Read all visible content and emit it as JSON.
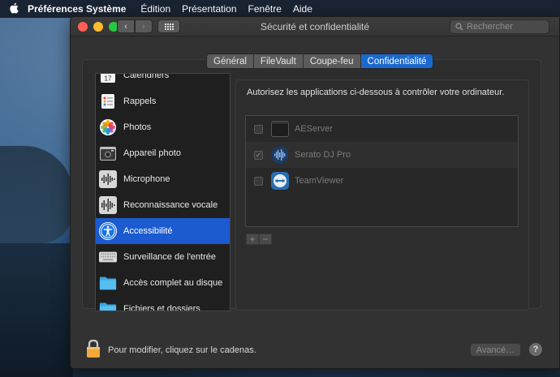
{
  "menubar": {
    "apple": "",
    "items": [
      "Préférences Système",
      "Édition",
      "Présentation",
      "Fenêtre",
      "Aide"
    ]
  },
  "window": {
    "title": "Sécurité et confidentialité",
    "search_placeholder": "Rechercher"
  },
  "tabs": [
    {
      "label": "Général",
      "active": false
    },
    {
      "label": "FileVault",
      "active": false
    },
    {
      "label": "Coupe-feu",
      "active": false
    },
    {
      "label": "Confidentialité",
      "active": true
    }
  ],
  "sidebar": {
    "items": [
      {
        "label": "Calendriers",
        "icon": "calendar-icon"
      },
      {
        "label": "Rappels",
        "icon": "reminders-icon"
      },
      {
        "label": "Photos",
        "icon": "photos-icon"
      },
      {
        "label": "Appareil photo",
        "icon": "camera-icon"
      },
      {
        "label": "Microphone",
        "icon": "microphone-icon"
      },
      {
        "label": "Reconnaissance vocale",
        "icon": "speech-recognition-icon"
      },
      {
        "label": "Accessibilité",
        "icon": "accessibility-icon",
        "selected": true
      },
      {
        "label": "Surveillance de l'entrée",
        "icon": "keyboard-icon"
      },
      {
        "label": "Accès complet au disque",
        "icon": "folder-icon"
      },
      {
        "label": "Fichiers et dossiers",
        "icon": "folder-icon"
      }
    ],
    "calendar_day": "17"
  },
  "main": {
    "instruction": "Autorisez les applications ci-dessous à contrôler votre ordinateur.",
    "apps": [
      {
        "name": "AEServer",
        "checked": false,
        "icon": "terminal-app-icon"
      },
      {
        "name": "Serato DJ Pro",
        "checked": true,
        "icon": "serato-icon"
      },
      {
        "name": "TeamViewer",
        "checked": false,
        "icon": "teamviewer-icon"
      }
    ],
    "add_label": "+",
    "remove_label": "−"
  },
  "footer": {
    "lock_text": "Pour modifier, cliquez sur le cadenas.",
    "advanced_label": "Avancé…",
    "help_label": "?"
  },
  "colors": {
    "accent": "#1c68d1",
    "selection": "#1c5bcf",
    "window_bg": "#323232"
  }
}
